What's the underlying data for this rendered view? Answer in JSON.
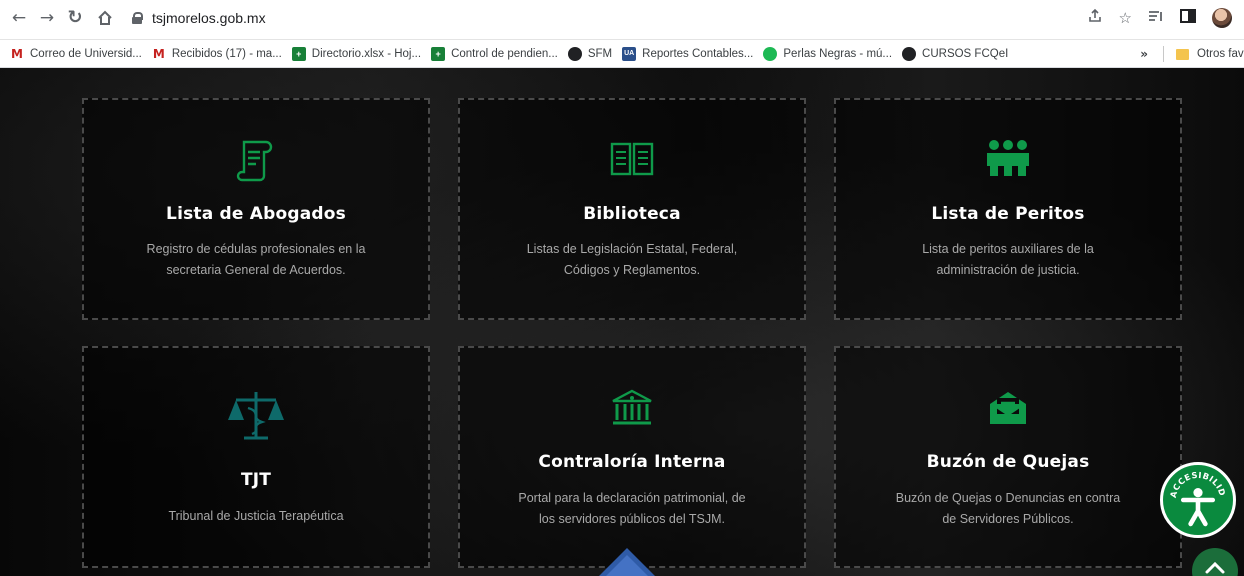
{
  "browser": {
    "url": "tsjmorelos.gob.mx",
    "bookmarks": [
      {
        "label": "Correo de Universid...",
        "icon": "gmail-icon"
      },
      {
        "label": "Recibidos (17) - ma...",
        "icon": "gmail-icon"
      },
      {
        "label": "Directorio.xlsx - Hoj...",
        "icon": "sheets-icon"
      },
      {
        "label": "Control de pendien...",
        "icon": "sheets-icon"
      },
      {
        "label": "SFM",
        "icon": "globe-icon"
      },
      {
        "label": "Reportes Contables...",
        "icon": "uam-icon"
      },
      {
        "label": "Perlas Negras - mú...",
        "icon": "spotify-icon"
      },
      {
        "label": "CURSOS FCQeI",
        "icon": "globe-icon"
      }
    ],
    "more": "»",
    "other_folder": "Otros favoritos"
  },
  "cards": [
    {
      "title": "Lista de Abogados",
      "desc1": "Registro de cédulas profesionales en la",
      "desc2": "secretaria General de Acuerdos.",
      "icon": "scroll-document-icon"
    },
    {
      "title": "Biblioteca",
      "desc1": "Listas de Legislación Estatal, Federal,",
      "desc2": "Códigos y Reglamentos.",
      "icon": "open-book-icon"
    },
    {
      "title": "Lista de Peritos",
      "desc1": "Lista de peritos auxiliares de la",
      "desc2": "administración de justicia.",
      "icon": "group-people-icon"
    },
    {
      "title": "TJT",
      "desc1": "Tribunal de Justicia Terapéutica",
      "desc2": "",
      "icon": "scales-caduceus-icon"
    },
    {
      "title": "Contraloría Interna",
      "desc1": "Portal para la declaración patrimonial, de",
      "desc2": "los servidores públicos del TSJM.",
      "icon": "government-building-icon"
    },
    {
      "title": "Buzón de Quejas",
      "desc1": "Buzón de Quejas o Denuncias en contra",
      "desc2": "de Servidores Públicos.",
      "icon": "mail-envelope-icon"
    }
  ],
  "accessibility": {
    "label": "ACCESIBILIDAD"
  },
  "colors": {
    "accent_green": "#0a8a3e",
    "background": "#0b0b0b"
  }
}
